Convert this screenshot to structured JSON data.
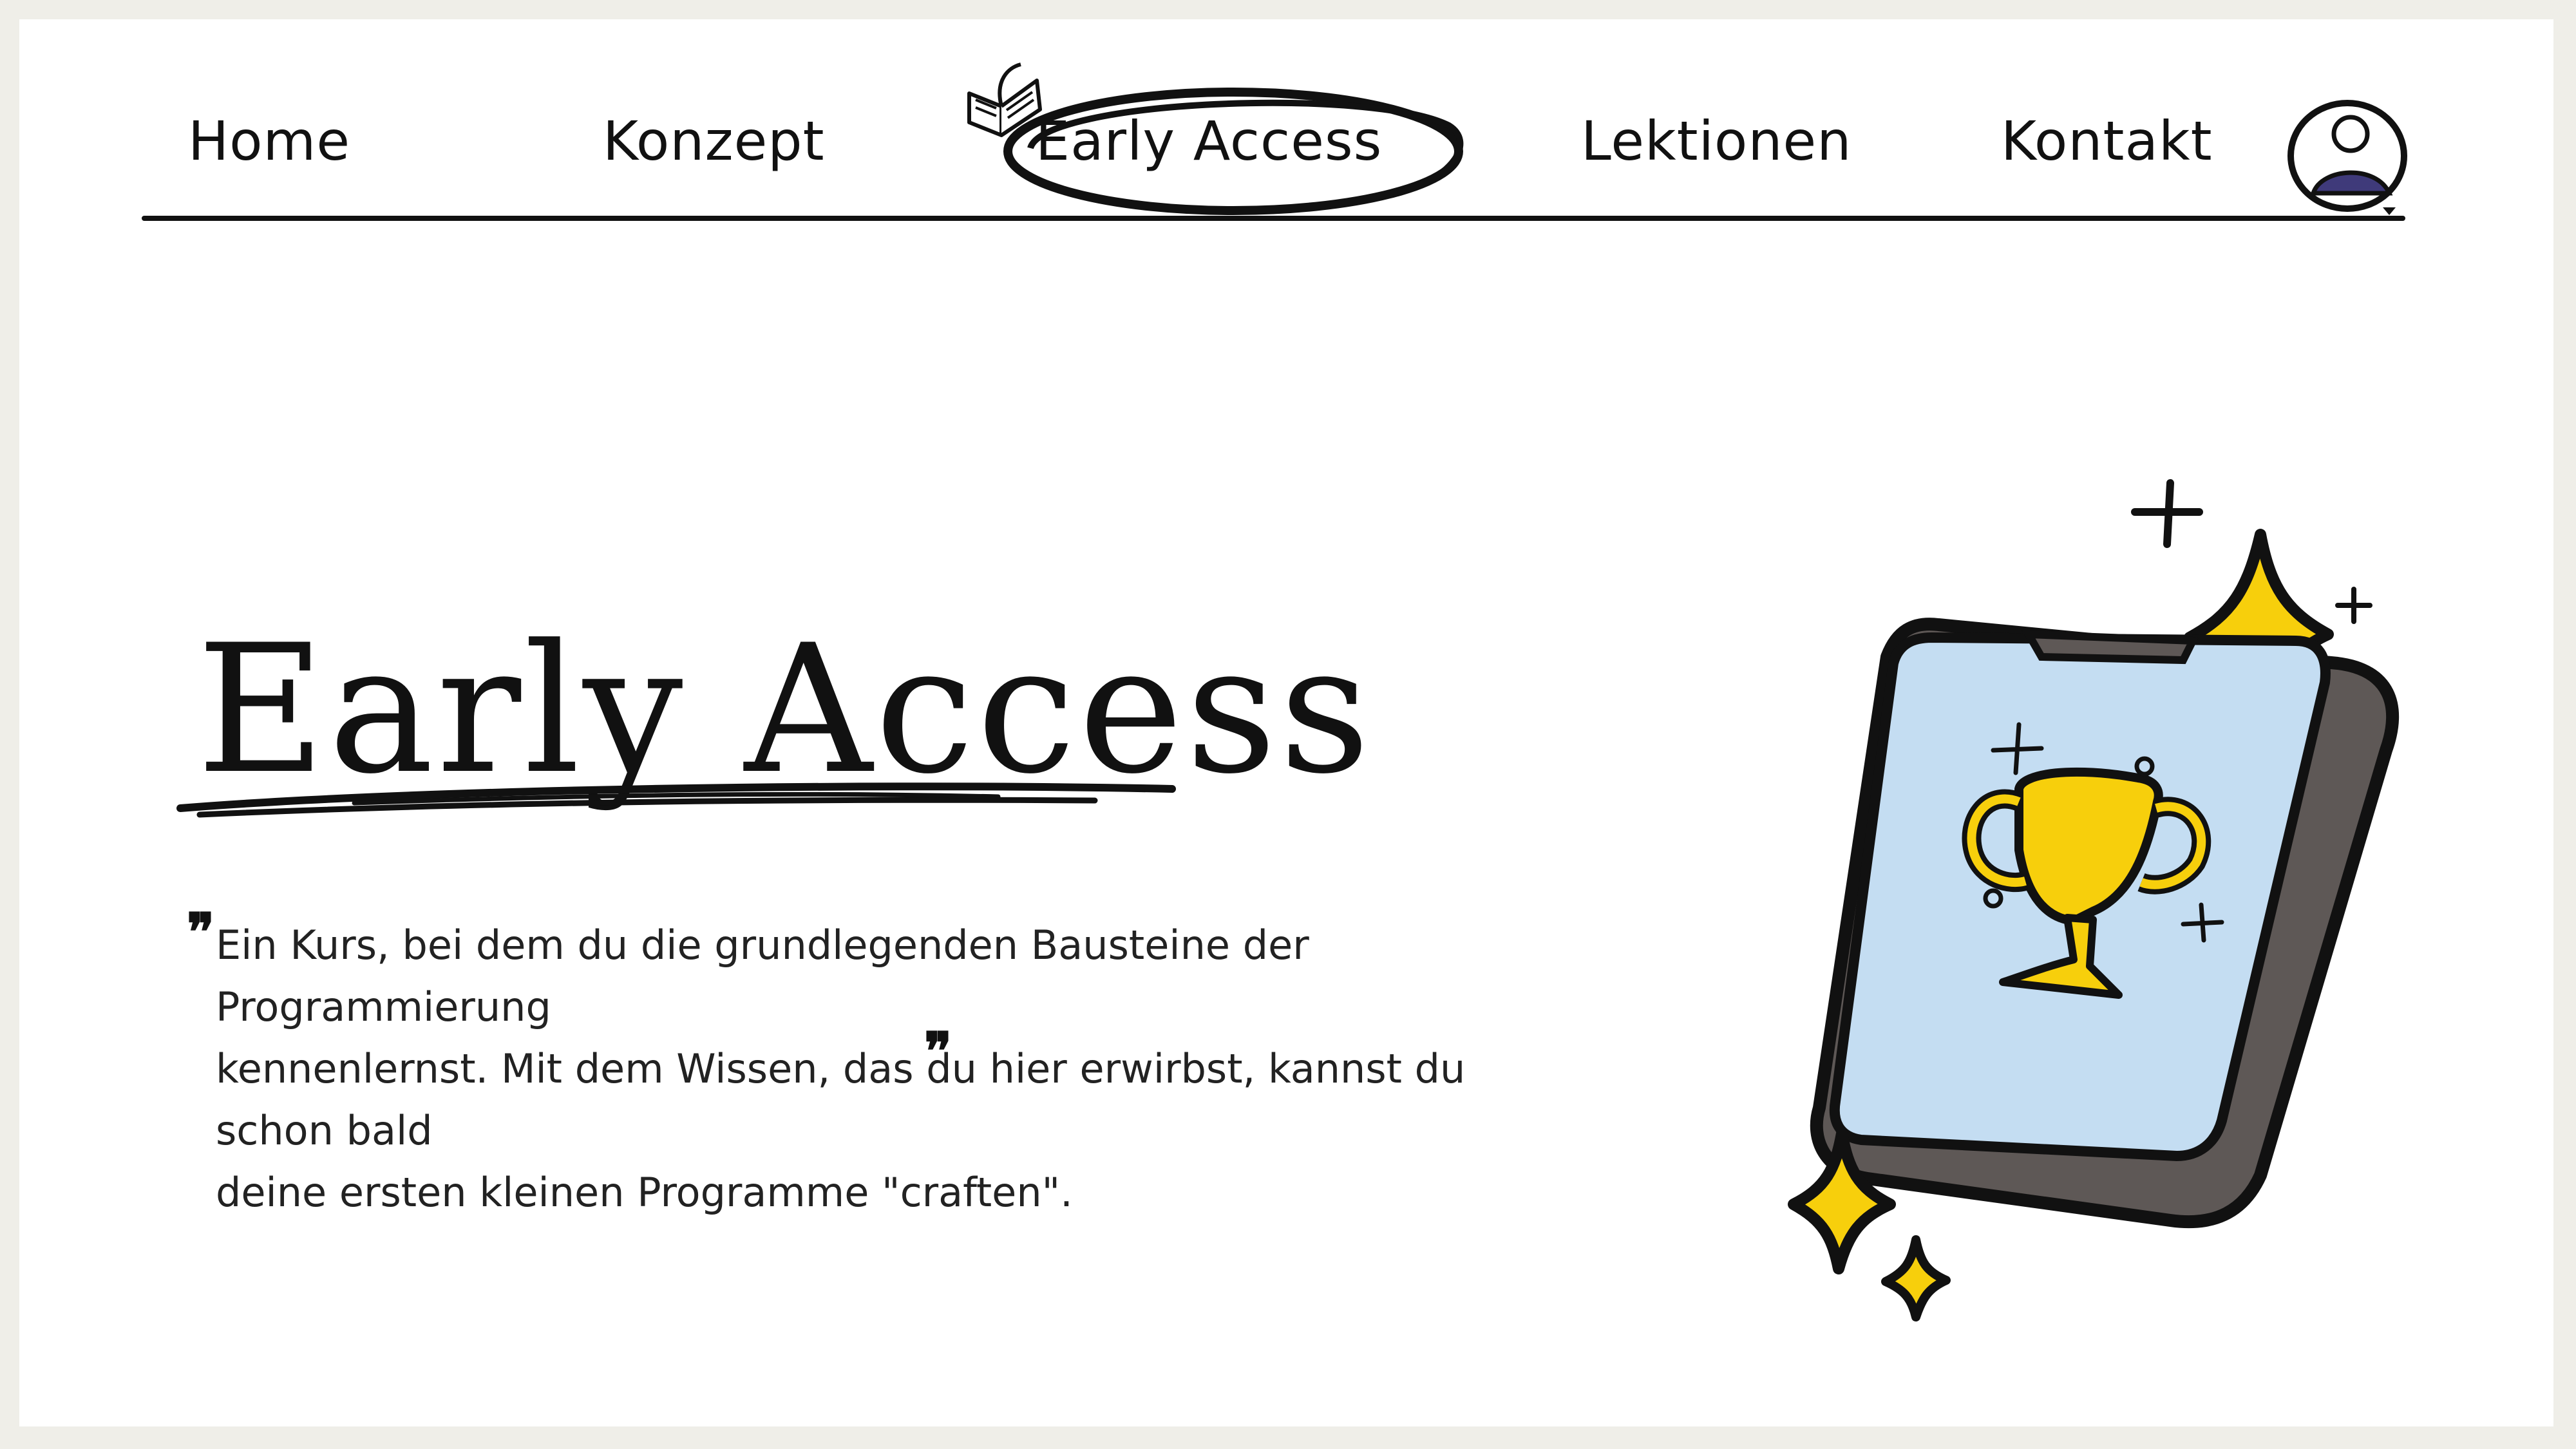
{
  "nav": {
    "items": [
      "Home",
      "Konzept",
      "Early Access",
      "Lektionen",
      "Kontakt"
    ],
    "active": "Early Access"
  },
  "icons": {
    "book": "open-book-icon",
    "avatar": "user-avatar-icon",
    "trophy": "trophy-icon",
    "phone": "smartphone-icon",
    "sparkles": "sparkle-icon"
  },
  "hero": {
    "title": "Early Access",
    "quote_open": "❞",
    "quote_close": "❞",
    "quote_lines": [
      "Ein Kurs, bei dem du die grundlegenden Bausteine der Programmierung",
      "kennenlernst. Mit dem Wissen, das du hier erwirbst, kannst du schon bald",
      "deine ersten kleinen Programme \"craften\"."
    ]
  },
  "colors": {
    "background": "#efeee8",
    "page": "#ffffff",
    "ink": "#111111",
    "screen": "#c4ddf2",
    "trophy": "#f7cf0c",
    "phone_body": "#5e5856",
    "avatar_shirt": "#3f3a7a"
  }
}
